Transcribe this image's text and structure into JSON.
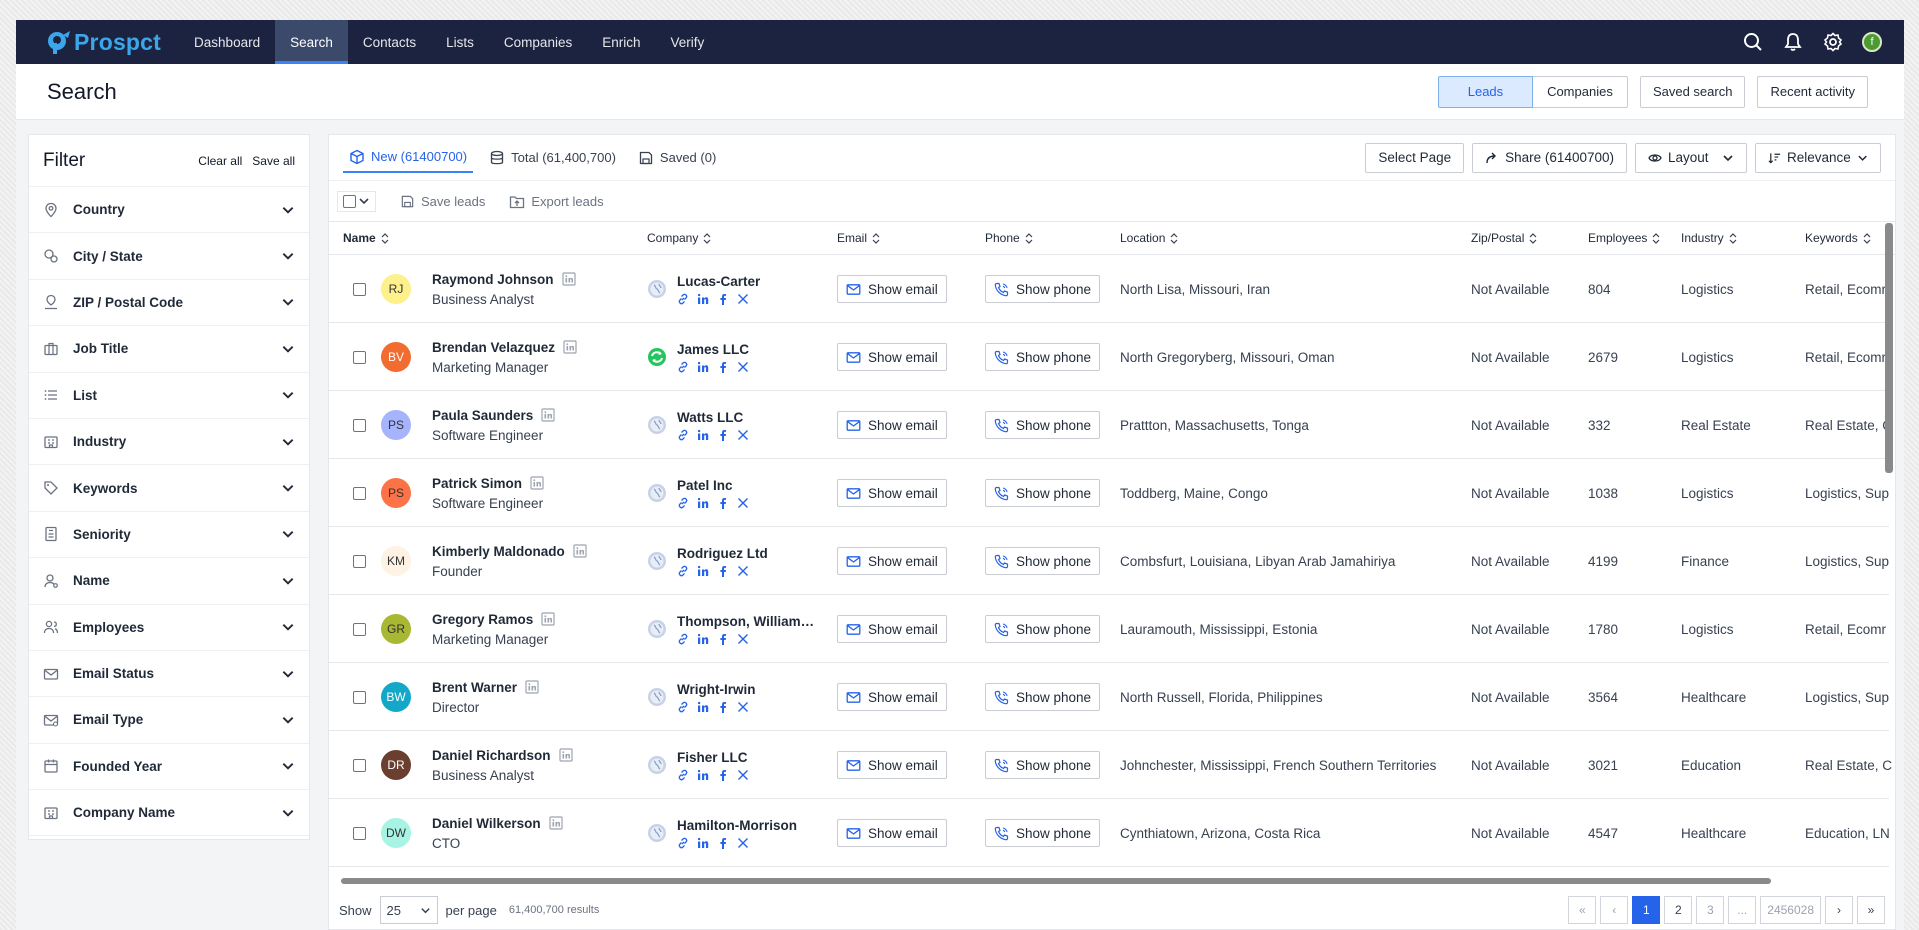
{
  "app": {
    "name": "Prospct"
  },
  "nav": {
    "items": [
      "Dashboard",
      "Search",
      "Contacts",
      "Lists",
      "Companies",
      "Enrich",
      "Verify"
    ],
    "active": "Search",
    "user_initial": "f"
  },
  "page": {
    "title": "Search",
    "actions": {
      "leads": "Leads",
      "companies": "Companies",
      "saved_search": "Saved search",
      "recent_activity": "Recent activity"
    }
  },
  "filter": {
    "title": "Filter",
    "clear_all": "Clear all",
    "save_all": "Save all",
    "items": [
      "Country",
      "City / State",
      "ZIP / Postal Code",
      "Job Title",
      "List",
      "Industry",
      "Keywords",
      "Seniority",
      "Name",
      "Employees",
      "Email Status",
      "Email Type",
      "Founded Year",
      "Company Name"
    ]
  },
  "tabs": {
    "new": "New (61400700)",
    "total": "Total (61,400,700)",
    "saved": "Saved (0)",
    "select_page": "Select Page",
    "share": "Share (61400700)",
    "layout": "Layout",
    "relevance": "Relevance"
  },
  "bulk": {
    "save_leads": "Save leads",
    "export_leads": "Export leads"
  },
  "columns": {
    "name": "Name",
    "company": "Company",
    "email": "Email",
    "phone": "Phone",
    "location": "Location",
    "zip": "Zip/Postal",
    "employees": "Employees",
    "industry": "Industry",
    "keywords": "Keywords"
  },
  "buttons": {
    "show_email": "Show email",
    "show_phone": "Show phone"
  },
  "rows": [
    {
      "initials": "RJ",
      "avatar_color": "#fef08a",
      "name": "Raymond Johnson",
      "title": "Business Analyst",
      "company": "Lucas-Carter",
      "logo": "globe",
      "location": "North Lisa, Missouri, Iran",
      "zip": "Not Available",
      "employees": "804",
      "industry": "Logistics",
      "keywords": "Retail, Ecomr"
    },
    {
      "initials": "BV",
      "avatar_color": "#f26b2f",
      "name": "Brendan Velazquez",
      "title": "Marketing Manager",
      "company": "James LLC",
      "logo": "green",
      "location": "North Gregoryberg, Missouri, Oman",
      "zip": "Not Available",
      "employees": "2679",
      "industry": "Logistics",
      "keywords": "Retail, Ecomr"
    },
    {
      "initials": "PS",
      "avatar_color": "#a5b4fc",
      "name": "Paula Saunders",
      "title": "Software Engineer",
      "company": "Watts LLC",
      "logo": "globe",
      "location": "Prattton, Massachusetts, Tonga",
      "zip": "Not Available",
      "employees": "332",
      "industry": "Real Estate",
      "keywords": "Real Estate, C"
    },
    {
      "initials": "PS",
      "avatar_color": "#fb7346",
      "name": "Patrick Simon",
      "title": "Software Engineer",
      "company": "Patel Inc",
      "logo": "globe",
      "location": "Toddberg, Maine, Congo",
      "zip": "Not Available",
      "employees": "1038",
      "industry": "Logistics",
      "keywords": "Logistics, Sup"
    },
    {
      "initials": "KM",
      "avatar_color": "#fdf2e3",
      "name": "Kimberly Maldonado",
      "title": "Founder",
      "company": "Rodriguez Ltd",
      "logo": "globe",
      "location": "Combsfurt, Louisiana, Libyan Arab Jamahiriya",
      "zip": "Not Available",
      "employees": "4199",
      "industry": "Finance",
      "keywords": "Logistics, Sup"
    },
    {
      "initials": "GR",
      "avatar_color": "#a8b833",
      "name": "Gregory Ramos",
      "title": "Marketing Manager",
      "company": "Thompson, Williams ...",
      "logo": "globe",
      "location": "Lauramouth, Mississippi, Estonia",
      "zip": "Not Available",
      "employees": "1780",
      "industry": "Logistics",
      "keywords": "Retail, Ecomr"
    },
    {
      "initials": "BW",
      "avatar_color": "#14a8c8",
      "name": "Brent Warner",
      "title": "Director",
      "company": "Wright-Irwin",
      "logo": "globe",
      "location": "North Russell, Florida, Philippines",
      "zip": "Not Available",
      "employees": "3564",
      "industry": "Healthcare",
      "keywords": "Logistics, Sup"
    },
    {
      "initials": "DR",
      "avatar_color": "#6b3f2f",
      "name": "Daniel Richardson",
      "title": "Business Analyst",
      "company": "Fisher LLC",
      "logo": "globe",
      "location": "Johnchester, Mississippi, French Southern Territories",
      "zip": "Not Available",
      "employees": "3021",
      "industry": "Education",
      "keywords": "Real Estate, C"
    },
    {
      "initials": "DW",
      "avatar_color": "#a7f3e4",
      "name": "Daniel Wilkerson",
      "title": "CTO",
      "company": "Hamilton-Morrison",
      "logo": "globe",
      "location": "Cynthiatown, Arizona, Costa Rica",
      "zip": "Not Available",
      "employees": "4547",
      "industry": "Healthcare",
      "keywords": "Education, LN"
    }
  ],
  "footer": {
    "show": "Show",
    "per_page_value": "25",
    "per_page": "per page",
    "results": "61,400,700 results",
    "pages": [
      "«",
      "‹",
      "1",
      "2",
      "3",
      "...",
      "2456028",
      "›",
      "»"
    ]
  }
}
